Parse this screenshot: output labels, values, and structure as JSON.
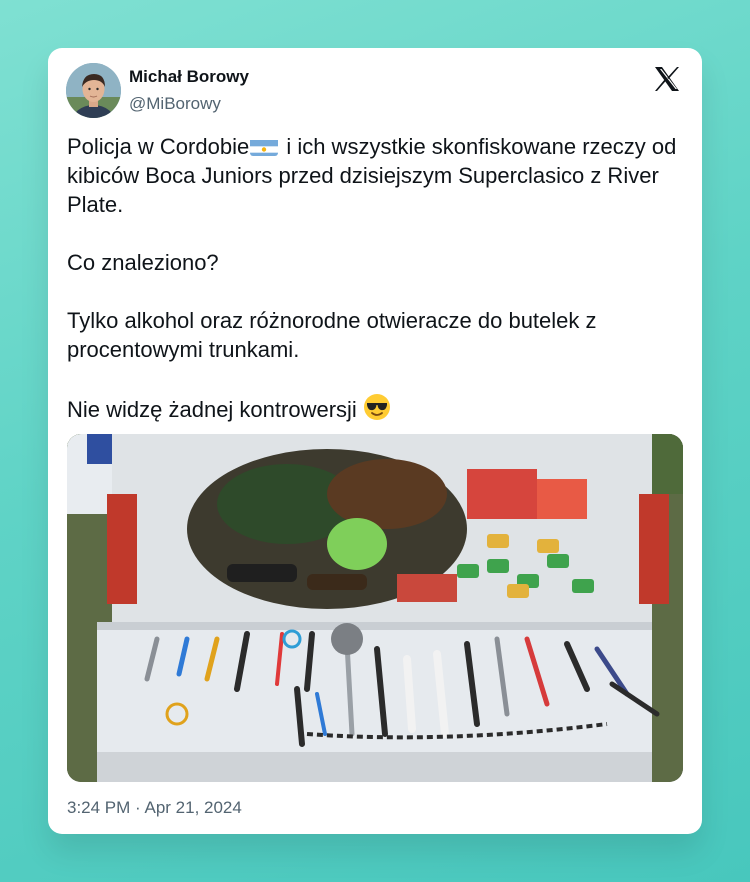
{
  "author": {
    "name": "Michał Borowy",
    "handle": "@MiBorowy"
  },
  "platform_logo": "x-logo-icon",
  "tweet": {
    "line1_a": "Policja w Cordobie",
    "line1_flag": "argentina-flag-icon",
    "line1_b": " i ich wszystkie skonfiskowane rzeczy od kibiców Boca Juniors przed dzisiejszym Superclasico z River Plate.",
    "para2": "Co znaleziono?",
    "para3": "Tylko alkohol oraz różnorodne otwieracze do butelek z procentowymi trunkami.",
    "para4": "Nie widzę żadnej kontrowersji",
    "para4_emoji": "sunglasses-face-emoji"
  },
  "media": {
    "icon": "photo-of-confiscated-items"
  },
  "timestamp": "3:24 PM · Apr 21, 2024",
  "colors": {
    "background_gradient_start": "#7fe0d2",
    "background_gradient_end": "#48c7bd",
    "card": "#ffffff",
    "text_primary": "#0f1419",
    "text_secondary": "#536471"
  }
}
